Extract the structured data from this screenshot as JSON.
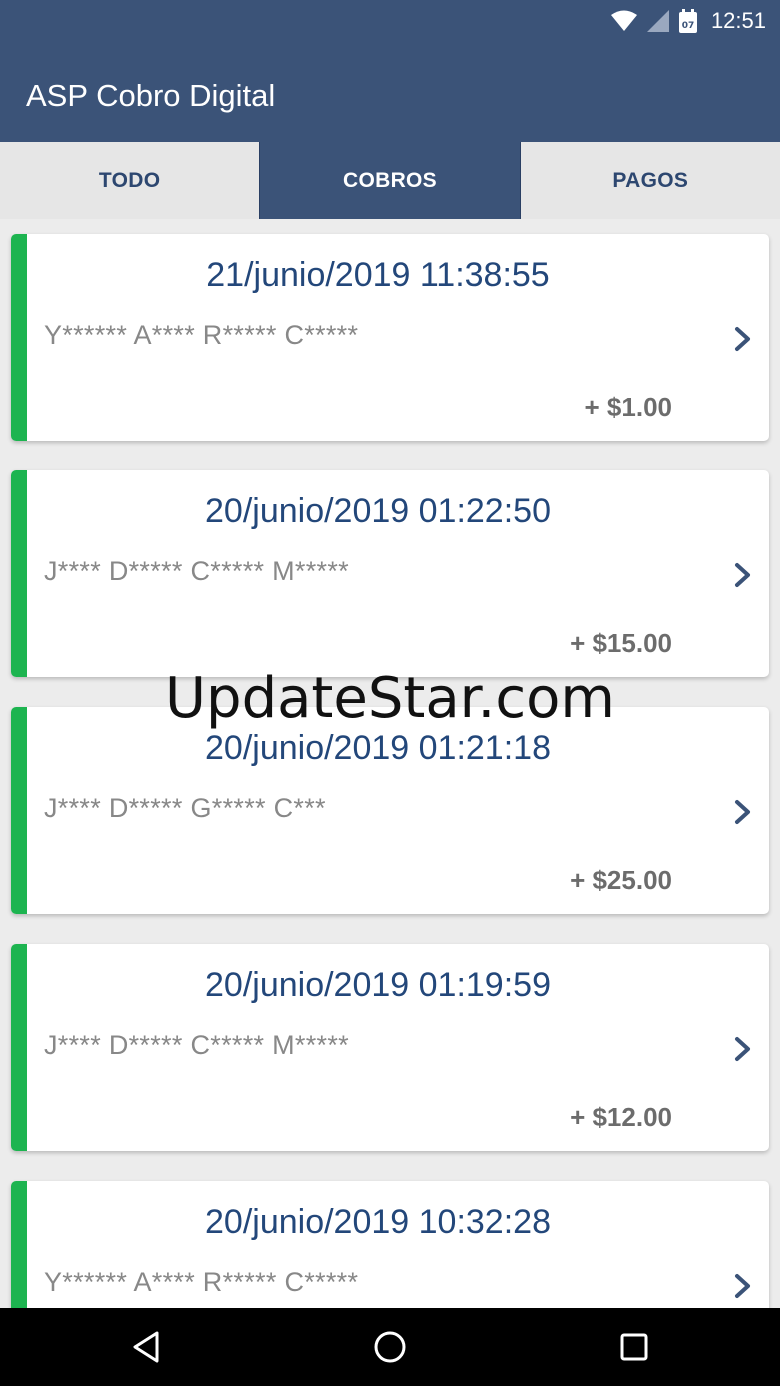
{
  "status_bar": {
    "time": "12:51",
    "calendar_day": "07",
    "icons": [
      "wifi-icon",
      "signal-icon",
      "calendar-icon"
    ]
  },
  "app": {
    "title": "ASP Cobro Digital"
  },
  "tabs": [
    {
      "label": "TODO",
      "active": false
    },
    {
      "label": "COBROS",
      "active": true
    },
    {
      "label": "PAGOS",
      "active": false
    }
  ],
  "transactions": [
    {
      "date": "21/junio/2019 11:38:55",
      "name": "Y****** A**** R***** C*****",
      "amount": "+ $1.00"
    },
    {
      "date": "20/junio/2019 01:22:50",
      "name": "J**** D***** C***** M*****",
      "amount": "+ $15.00"
    },
    {
      "date": "20/junio/2019 01:21:18",
      "name": "J**** D***** G***** C***",
      "amount": "+ $25.00"
    },
    {
      "date": "20/junio/2019 01:19:59",
      "name": "J**** D***** C***** M*****",
      "amount": "+ $12.00"
    },
    {
      "date": "20/junio/2019 10:32:28",
      "name": "Y****** A**** R***** C*****",
      "amount": ""
    }
  ],
  "watermark": "UpdateStar.com",
  "colors": {
    "app_bar": "#3b5378",
    "accent_green": "#1db450",
    "date_text": "#23477a"
  },
  "nav": {
    "icons": [
      "back-icon",
      "home-icon",
      "recents-icon"
    ]
  }
}
